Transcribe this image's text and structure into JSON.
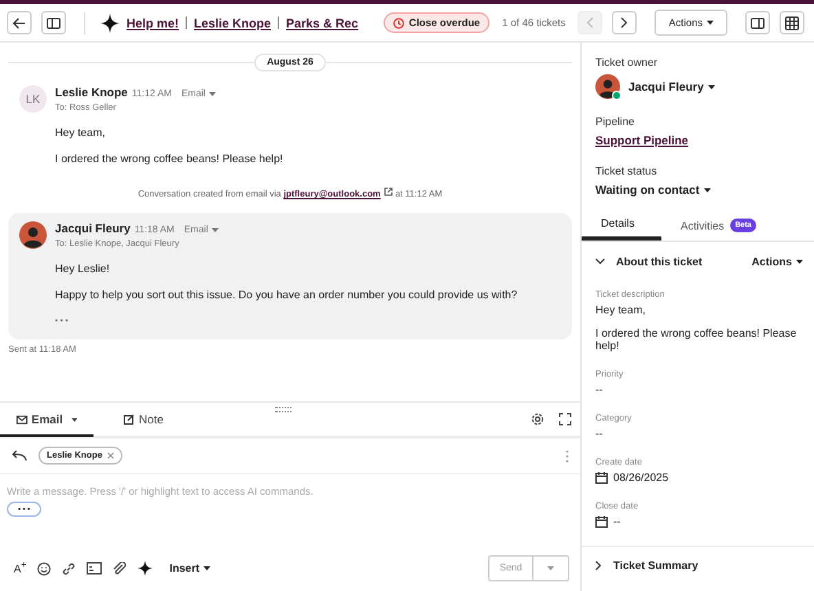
{
  "header": {
    "breadcrumbs": [
      "Help me!",
      "Leslie Knope",
      "Parks & Rec"
    ],
    "badge": "Close overdue",
    "counter": "1 of 46 tickets",
    "prev_disabled": true,
    "actions": "Actions"
  },
  "thread": {
    "date": "August 26",
    "messages": [
      {
        "kind": "incoming",
        "initials": "LK",
        "sender": "Leslie Knope",
        "time": "11:12 AM",
        "channel": "Email",
        "to": "To: Ross Geller",
        "body": [
          "Hey team,",
          "I ordered the wrong coffee beans! Please help!"
        ]
      },
      {
        "kind": "system",
        "text": "Conversation created from email via",
        "link": "jptfleury@outlook.com",
        "suffix": "at 11:12 AM"
      },
      {
        "kind": "outgoing",
        "sender": "Jacqui Fleury",
        "time": "11:18 AM",
        "channel": "Email",
        "to": "To: Leslie Knope, Jacqui Fleury",
        "body": [
          "Hey Leslie!",
          "Happy to help you sort out this issue. Do you have an order number you could provide us with?"
        ],
        "more": "• • •",
        "sent": "Sent at 11:18 AM"
      }
    ]
  },
  "composer": {
    "tabs": [
      {
        "label": "Email",
        "selected": true
      },
      {
        "label": "Note",
        "selected": false
      }
    ],
    "recipient": "Leslie Knope",
    "placeholder": "Write a message. Press '/' or highlight text to access AI commands.",
    "more": "• • •",
    "format": "A$^{+}$",
    "insert": "Insert",
    "send": "Send"
  },
  "sidebar": {
    "owner_label": "Ticket owner",
    "owner": "Jacqui Fleury",
    "owner_online": true,
    "pipeline_label": "Pipeline",
    "pipeline": "Support Pipeline",
    "status_label": "Ticket status",
    "status": "Waiting on contact",
    "tabs": [
      {
        "label": "Details",
        "selected": true
      },
      {
        "label": "Activities",
        "badge": "Beta",
        "selected": false
      }
    ],
    "section": "About this ticket",
    "section_actions": "Actions",
    "fields": [
      {
        "kind": "text",
        "label": "Ticket description",
        "value": [
          "Hey team,",
          "I ordered the wrong coffee beans! Please help!"
        ]
      },
      {
        "kind": "text",
        "label": "Priority",
        "value": [
          "--"
        ]
      },
      {
        "kind": "text",
        "label": "Category",
        "value": [
          "--"
        ]
      },
      {
        "kind": "date",
        "label": "Create date",
        "value": [
          "08/26/2025"
        ]
      },
      {
        "kind": "date",
        "label": "Close date",
        "value": [
          "--"
        ]
      }
    ],
    "next_section": "Ticket Summary"
  }
}
